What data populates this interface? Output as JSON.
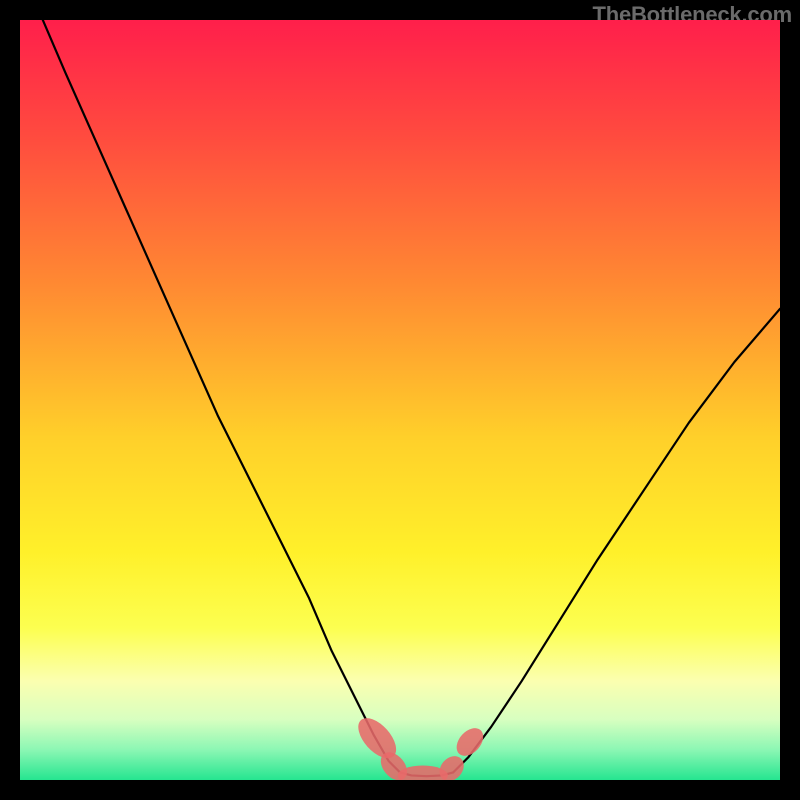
{
  "attribution": "TheBottleneck.com",
  "chart_data": {
    "type": "line",
    "title": "",
    "xlabel": "",
    "ylabel": "",
    "xlim": [
      0,
      100
    ],
    "ylim": [
      0,
      100
    ],
    "grid": false,
    "legend": false,
    "background_gradient_stops": [
      {
        "offset": 0.0,
        "color": "#ff1f4b"
      },
      {
        "offset": 0.15,
        "color": "#ff4a3f"
      },
      {
        "offset": 0.35,
        "color": "#ff8a32"
      },
      {
        "offset": 0.55,
        "color": "#ffd02a"
      },
      {
        "offset": 0.7,
        "color": "#fff02a"
      },
      {
        "offset": 0.8,
        "color": "#fcff50"
      },
      {
        "offset": 0.87,
        "color": "#fbffb0"
      },
      {
        "offset": 0.92,
        "color": "#d8ffc0"
      },
      {
        "offset": 0.96,
        "color": "#8cf7b4"
      },
      {
        "offset": 1.0,
        "color": "#25e590"
      }
    ],
    "series": [
      {
        "name": "left-curve",
        "color": "#000000",
        "width": 2.2,
        "x": [
          3,
          6,
          10,
          14,
          18,
          22,
          26,
          30,
          34,
          38,
          41,
          44,
          46.5,
          48.5,
          50
        ],
        "y": [
          100,
          93,
          84,
          75,
          66,
          57,
          48,
          40,
          32,
          24,
          17,
          11,
          6,
          2.5,
          1
        ]
      },
      {
        "name": "right-curve",
        "color": "#000000",
        "width": 2.2,
        "x": [
          57,
          59,
          62,
          66,
          71,
          76,
          82,
          88,
          94,
          100
        ],
        "y": [
          1,
          3,
          7,
          13,
          21,
          29,
          38,
          47,
          55,
          62
        ]
      },
      {
        "name": "floor",
        "color": "#000000",
        "width": 2.2,
        "x": [
          50,
          51.5,
          53.5,
          55.5,
          57
        ],
        "y": [
          1,
          0.6,
          0.5,
          0.6,
          1
        ]
      }
    ],
    "markers": [
      {
        "name": "marker-left-upper",
        "cx": 47.0,
        "cy": 5.5,
        "rx": 1.7,
        "ry": 3.2,
        "rotation": -42,
        "color": "#e86a6a"
      },
      {
        "name": "marker-left-lower",
        "cx": 49.2,
        "cy": 1.8,
        "rx": 1.4,
        "ry": 2.1,
        "rotation": -40,
        "color": "#e86a6a"
      },
      {
        "name": "marker-floor",
        "cx": 53.0,
        "cy": 0.6,
        "rx": 3.3,
        "ry": 1.3,
        "rotation": 0,
        "color": "#e86a6a"
      },
      {
        "name": "marker-right-lower",
        "cx": 56.8,
        "cy": 1.5,
        "rx": 1.4,
        "ry": 1.8,
        "rotation": 42,
        "color": "#e86a6a"
      },
      {
        "name": "marker-right-upper",
        "cx": 59.2,
        "cy": 5.0,
        "rx": 1.4,
        "ry": 2.1,
        "rotation": 42,
        "color": "#e86a6a"
      }
    ]
  }
}
